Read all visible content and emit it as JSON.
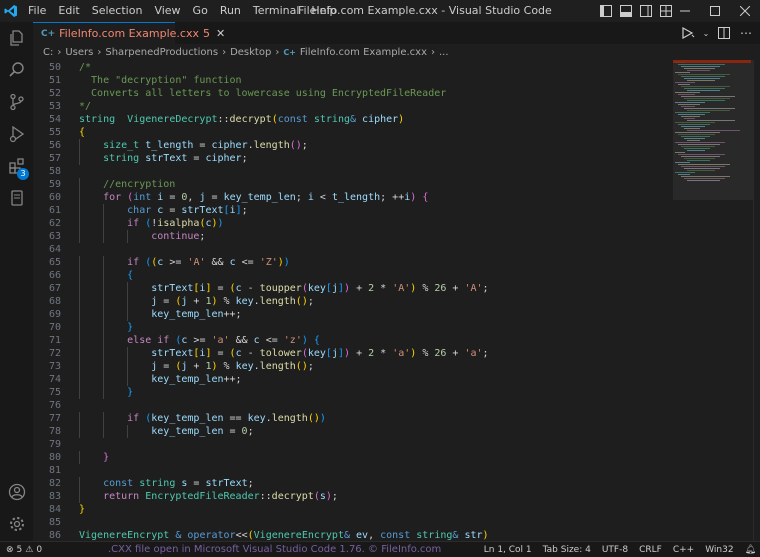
{
  "menu": [
    "File",
    "Edit",
    "Selection",
    "View",
    "Go",
    "Run",
    "Terminal",
    "Help"
  ],
  "window": {
    "title": "FileInfo.com Example.cxx - Visual Studio Code"
  },
  "activity": {
    "extensions_badge": "3"
  },
  "tab": {
    "label": "FileInfo.com Example.cxx",
    "problems": "5",
    "icon_text": "C++"
  },
  "breadcrumb": [
    "C:",
    "Users",
    "SharpenedProductions",
    "Desktop",
    "FileInfo.com Example.cxx",
    "..."
  ],
  "code": {
    "lines": [
      {
        "n": "50",
        "indent": 0,
        "t": [
          [
            "cm",
            "/*"
          ]
        ]
      },
      {
        "n": "51",
        "indent": 0,
        "t": [
          [
            "cm",
            "  The \"decryption\" function"
          ]
        ]
      },
      {
        "n": "52",
        "indent": 0,
        "t": [
          [
            "cm",
            "  Converts all letters to lowercase using EncryptedFileReader"
          ]
        ]
      },
      {
        "n": "53",
        "indent": 0,
        "t": [
          [
            "cm",
            "*/"
          ]
        ]
      },
      {
        "n": "54",
        "indent": 0,
        "t": [
          [
            "ty",
            "string"
          ],
          [
            "",
            "  "
          ],
          [
            "ty",
            "VigenereDecrypt"
          ],
          [
            "",
            "::"
          ],
          [
            "fn",
            "decrypt"
          ],
          [
            "b1",
            "("
          ],
          [
            "kw",
            "const"
          ],
          [
            "",
            " "
          ],
          [
            "ty",
            "string"
          ],
          [
            "kw",
            "&"
          ],
          [
            "",
            " "
          ],
          [
            "var",
            "cipher"
          ],
          [
            "b1",
            ")"
          ]
        ]
      },
      {
        "n": "55",
        "indent": 0,
        "t": [
          [
            "b1",
            "{"
          ]
        ]
      },
      {
        "n": "56",
        "indent": 1,
        "t": [
          [
            "ty",
            "size_t"
          ],
          [
            "",
            " "
          ],
          [
            "var",
            "t_length"
          ],
          [
            "",
            " = "
          ],
          [
            "var",
            "cipher"
          ],
          [
            "",
            "."
          ],
          [
            "fn",
            "length"
          ],
          [
            "b2",
            "()"
          ],
          [
            ";",
            ""
          ]
        ]
      },
      {
        "n": "57",
        "indent": 1,
        "t": [
          [
            "ty",
            "string"
          ],
          [
            "",
            " "
          ],
          [
            "var",
            "strText"
          ],
          [
            "",
            " = "
          ],
          [
            "var",
            "cipher"
          ],
          [
            ";",
            ""
          ]
        ]
      },
      {
        "n": "58",
        "indent": 0,
        "t": []
      },
      {
        "n": "59",
        "indent": 1,
        "t": [
          [
            "cm",
            "//encryption"
          ]
        ]
      },
      {
        "n": "60",
        "indent": 1,
        "t": [
          [
            "ctl",
            "for"
          ],
          [
            "",
            " "
          ],
          [
            "b2",
            "("
          ],
          [
            "kw",
            "int"
          ],
          [
            "",
            " "
          ],
          [
            "var",
            "i"
          ],
          [
            "",
            " = "
          ],
          [
            "num",
            "0"
          ],
          [
            ", ",
            " "
          ],
          [
            "var",
            "j"
          ],
          [
            "",
            " = "
          ],
          [
            "var",
            "key_temp_len"
          ],
          [
            "; ",
            ""
          ],
          [
            "var",
            "i"
          ],
          [
            "",
            " < "
          ],
          [
            "var",
            "t_length"
          ],
          [
            "; ",
            ""
          ],
          [
            "",
            "++"
          ],
          [
            "var",
            "i"
          ],
          [
            "b2",
            ")"
          ],
          [
            "",
            " "
          ],
          [
            "b2",
            "{"
          ]
        ]
      },
      {
        "n": "61",
        "indent": 2,
        "t": [
          [
            "kw",
            "char"
          ],
          [
            "",
            " "
          ],
          [
            "var",
            "c"
          ],
          [
            "",
            " = "
          ],
          [
            "var",
            "strText"
          ],
          [
            "b3",
            "["
          ],
          [
            "var",
            "i"
          ],
          [
            "b3",
            "]"
          ],
          [
            ";",
            ""
          ]
        ]
      },
      {
        "n": "62",
        "indent": 2,
        "t": [
          [
            "ctl",
            "if"
          ],
          [
            "",
            " "
          ],
          [
            "b3",
            "("
          ],
          [
            "",
            "!"
          ],
          [
            "fn",
            "isalpha"
          ],
          [
            "b1",
            "("
          ],
          [
            "var",
            "c"
          ],
          [
            "b1",
            ")"
          ],
          [
            "b3",
            ")"
          ]
        ]
      },
      {
        "n": "63",
        "indent": 3,
        "t": [
          [
            "ctl",
            "continue"
          ],
          [
            ";",
            ""
          ]
        ]
      },
      {
        "n": "64",
        "indent": 0,
        "t": []
      },
      {
        "n": "65",
        "indent": 2,
        "t": [
          [
            "ctl",
            "if"
          ],
          [
            "",
            " "
          ],
          [
            "b3",
            "("
          ],
          [
            "b1",
            "("
          ],
          [
            "var",
            "c"
          ],
          [
            "",
            " >= "
          ],
          [
            "str",
            "'A'"
          ],
          [
            "",
            " && "
          ],
          [
            "var",
            "c"
          ],
          [
            "",
            " <= "
          ],
          [
            "str",
            "'Z'"
          ],
          [
            "b1",
            ")"
          ],
          [
            "b3",
            ")"
          ]
        ]
      },
      {
        "n": "66",
        "indent": 2,
        "t": [
          [
            "b3",
            "{"
          ]
        ]
      },
      {
        "n": "67",
        "indent": 3,
        "t": [
          [
            "var",
            "strText"
          ],
          [
            "b1",
            "["
          ],
          [
            "var",
            "i"
          ],
          [
            "b1",
            "]"
          ],
          [
            "",
            " = "
          ],
          [
            "b1",
            "("
          ],
          [
            "var",
            "c"
          ],
          [
            "",
            " - "
          ],
          [
            "fn",
            "toupper"
          ],
          [
            "b2",
            "("
          ],
          [
            "var",
            "key"
          ],
          [
            "b3",
            "["
          ],
          [
            "var",
            "j"
          ],
          [
            "b3",
            "]"
          ],
          [
            "b2",
            ")"
          ],
          [
            "",
            " + "
          ],
          [
            "num",
            "2"
          ],
          [
            "",
            " * "
          ],
          [
            "str",
            "'A'"
          ],
          [
            "b1",
            ")"
          ],
          [
            "",
            " % "
          ],
          [
            "num",
            "26"
          ],
          [
            "",
            " + "
          ],
          [
            "str",
            "'A'"
          ],
          [
            ";",
            ""
          ]
        ]
      },
      {
        "n": "68",
        "indent": 3,
        "t": [
          [
            "var",
            "j"
          ],
          [
            "",
            " = "
          ],
          [
            "b1",
            "("
          ],
          [
            "var",
            "j"
          ],
          [
            "",
            " + "
          ],
          [
            "num",
            "1"
          ],
          [
            "b1",
            ")"
          ],
          [
            "",
            " % "
          ],
          [
            "var",
            "key"
          ],
          [
            "",
            "."
          ],
          [
            "fn",
            "length"
          ],
          [
            "b1",
            "()"
          ],
          [
            ";",
            ""
          ]
        ]
      },
      {
        "n": "69",
        "indent": 3,
        "t": [
          [
            "var",
            "key_temp_len"
          ],
          [
            "",
            "++;"
          ]
        ]
      },
      {
        "n": "70",
        "indent": 2,
        "t": [
          [
            "b3",
            "}"
          ]
        ]
      },
      {
        "n": "71",
        "indent": 2,
        "t": [
          [
            "ctl",
            "else if"
          ],
          [
            "",
            " "
          ],
          [
            "b3",
            "("
          ],
          [
            "var",
            "c"
          ],
          [
            "",
            " >= "
          ],
          [
            "str",
            "'a'"
          ],
          [
            "",
            " && "
          ],
          [
            "var",
            "c"
          ],
          [
            "",
            " <= "
          ],
          [
            "str",
            "'z'"
          ],
          [
            "b3",
            ")"
          ],
          [
            "",
            " "
          ],
          [
            "b3",
            "{"
          ]
        ]
      },
      {
        "n": "72",
        "indent": 3,
        "t": [
          [
            "var",
            "strText"
          ],
          [
            "b1",
            "["
          ],
          [
            "var",
            "i"
          ],
          [
            "b1",
            "]"
          ],
          [
            "",
            " = "
          ],
          [
            "b1",
            "("
          ],
          [
            "var",
            "c"
          ],
          [
            "",
            " - "
          ],
          [
            "fn",
            "tolower"
          ],
          [
            "b2",
            "("
          ],
          [
            "var",
            "key"
          ],
          [
            "b3",
            "["
          ],
          [
            "var",
            "j"
          ],
          [
            "b3",
            "]"
          ],
          [
            "b2",
            ")"
          ],
          [
            "",
            " + "
          ],
          [
            "num",
            "2"
          ],
          [
            "",
            " * "
          ],
          [
            "str",
            "'a'"
          ],
          [
            "b1",
            ")"
          ],
          [
            "",
            " % "
          ],
          [
            "num",
            "26"
          ],
          [
            "",
            " + "
          ],
          [
            "str",
            "'a'"
          ],
          [
            ";",
            ""
          ]
        ]
      },
      {
        "n": "73",
        "indent": 3,
        "t": [
          [
            "var",
            "j"
          ],
          [
            "",
            " = "
          ],
          [
            "b1",
            "("
          ],
          [
            "var",
            "j"
          ],
          [
            "",
            " + "
          ],
          [
            "num",
            "1"
          ],
          [
            "b1",
            ")"
          ],
          [
            "",
            " % "
          ],
          [
            "var",
            "key"
          ],
          [
            "",
            "."
          ],
          [
            "fn",
            "length"
          ],
          [
            "b1",
            "()"
          ],
          [
            ";",
            ""
          ]
        ]
      },
      {
        "n": "74",
        "indent": 3,
        "t": [
          [
            "var",
            "key_temp_len"
          ],
          [
            "",
            "++;"
          ]
        ]
      },
      {
        "n": "75",
        "indent": 2,
        "t": [
          [
            "b3",
            "}"
          ]
        ]
      },
      {
        "n": "76",
        "indent": 0,
        "t": []
      },
      {
        "n": "77",
        "indent": 2,
        "t": [
          [
            "ctl",
            "if"
          ],
          [
            "",
            " "
          ],
          [
            "b3",
            "("
          ],
          [
            "var",
            "key_temp_len"
          ],
          [
            "",
            " == "
          ],
          [
            "var",
            "key"
          ],
          [
            "",
            "."
          ],
          [
            "fn",
            "length"
          ],
          [
            "b1",
            "()"
          ],
          [
            "b3",
            ")"
          ]
        ]
      },
      {
        "n": "78",
        "indent": 3,
        "t": [
          [
            "var",
            "key_temp_len"
          ],
          [
            "",
            " = "
          ],
          [
            "num",
            "0"
          ],
          [
            ";",
            ""
          ]
        ]
      },
      {
        "n": "79",
        "indent": 0,
        "t": []
      },
      {
        "n": "80",
        "indent": 1,
        "t": [
          [
            "b2",
            "}"
          ]
        ]
      },
      {
        "n": "81",
        "indent": 0,
        "t": []
      },
      {
        "n": "82",
        "indent": 1,
        "t": [
          [
            "kw",
            "const"
          ],
          [
            "",
            " "
          ],
          [
            "ty",
            "string"
          ],
          [
            "",
            " "
          ],
          [
            "var",
            "s"
          ],
          [
            "",
            " = "
          ],
          [
            "var",
            "strText"
          ],
          [
            ";",
            ""
          ]
        ]
      },
      {
        "n": "83",
        "indent": 1,
        "t": [
          [
            "ctl",
            "return"
          ],
          [
            "",
            " "
          ],
          [
            "ty",
            "EncryptedFileReader"
          ],
          [
            "",
            "::"
          ],
          [
            "fn",
            "decrypt"
          ],
          [
            "b2",
            "("
          ],
          [
            "var",
            "s"
          ],
          [
            "b2",
            ")"
          ],
          [
            ";",
            ""
          ]
        ]
      },
      {
        "n": "84",
        "indent": 0,
        "t": [
          [
            "b1",
            "}"
          ]
        ]
      },
      {
        "n": "85",
        "indent": 0,
        "t": []
      },
      {
        "n": "86",
        "indent": 0,
        "t": [
          [
            "ty",
            "VigenereEncrypt"
          ],
          [
            "",
            " "
          ],
          [
            "kw",
            "&"
          ],
          [
            "",
            " "
          ],
          [
            "kw",
            "operator"
          ],
          [
            "",
            "<<"
          ],
          [
            "b1",
            "("
          ],
          [
            "ty",
            "VigenereEncrypt"
          ],
          [
            "kw",
            "&"
          ],
          [
            "",
            " "
          ],
          [
            "var",
            "ev"
          ],
          [
            ", ",
            ""
          ],
          [
            "kw",
            "const"
          ],
          [
            "",
            " "
          ],
          [
            "ty",
            "string"
          ],
          [
            "kw",
            "&"
          ],
          [
            "",
            " "
          ],
          [
            "var",
            "str"
          ],
          [
            "b1",
            ")"
          ]
        ]
      }
    ]
  },
  "status": {
    "errors": "5",
    "warnings": "0",
    "watermark": ".CXX file open in Microsoft Visual Studio Code 1.76. © FileInfo.com",
    "position": "Ln 1, Col 1",
    "tab_size": "Tab Size: 4",
    "encoding": "UTF-8",
    "eol": "CRLF",
    "language": "C++",
    "platform": "Win32"
  },
  "colors": {
    "accent": "#0078d4",
    "error": "#f48771"
  },
  "icons": {
    "activity": [
      "explorer-icon",
      "search-icon",
      "source-control-icon",
      "run-debug-icon",
      "extensions-icon",
      "remote-icon",
      "accounts-icon",
      "settings-gear-icon"
    ]
  }
}
